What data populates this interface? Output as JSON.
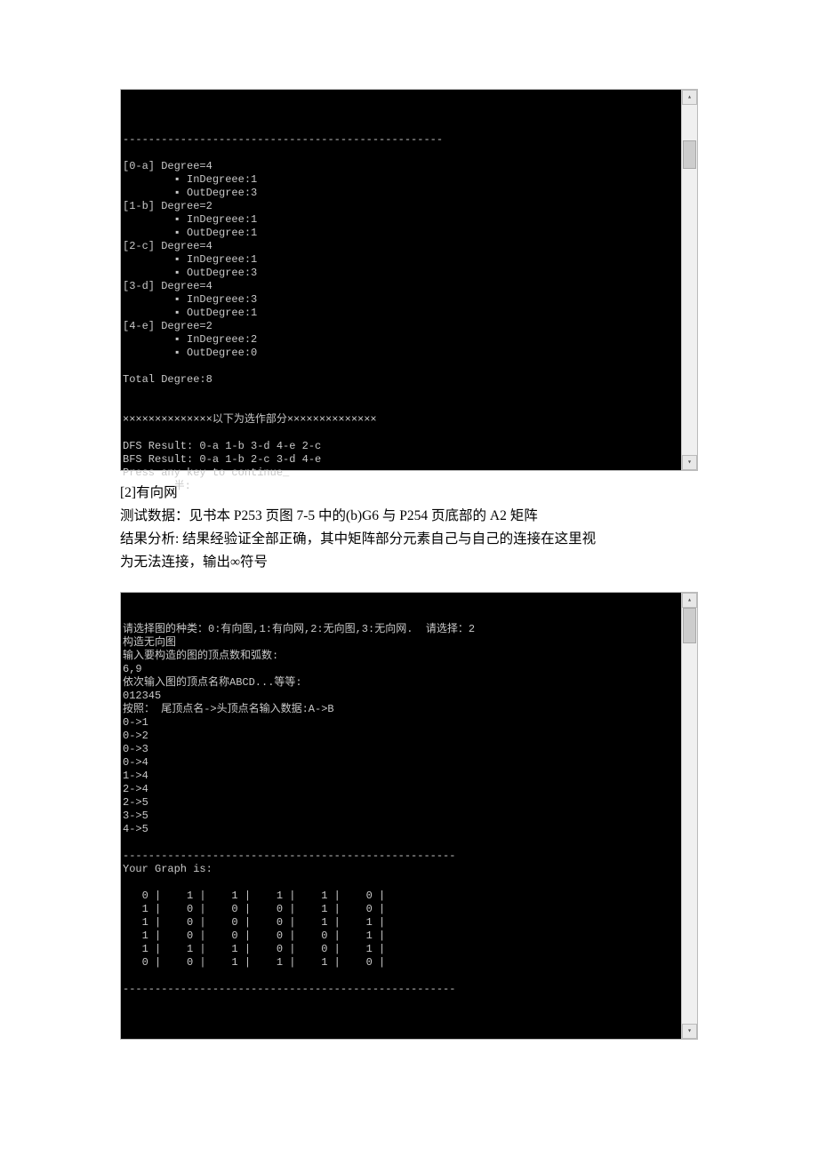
{
  "console1": {
    "divider": "--------------------------------------------------",
    "nodes": [
      {
        "header": "[0-a] Degree=4",
        "in": "▪ InDegreee:1",
        "out": "▪ OutDegree:3"
      },
      {
        "header": "[1-b] Degree=2",
        "in": "▪ InDegreee:1",
        "out": "▪ OutDegree:1"
      },
      {
        "header": "[2-c] Degree=4",
        "in": "▪ InDegreee:1",
        "out": "▪ OutDegree:3"
      },
      {
        "header": "[3-d] Degree=4",
        "in": "▪ InDegreee:3",
        "out": "▪ OutDegree:1"
      },
      {
        "header": "[4-e] Degree=2",
        "in": "▪ InDegreee:2",
        "out": "▪ OutDegree:0"
      }
    ],
    "total": "Total Degree:8",
    "section": "××××××××××××××以下为选作部分××××××××××××××",
    "dfs": "DFS Result: 0-a 1-b 3-d 4-e 2-c",
    "bfs": "BFS Result: 0-a 1-b 2-c 3-d 4-e",
    "pressKey": "Press any key to continue_",
    "tail": "        半:"
  },
  "doc": {
    "line1": "[2]有向网",
    "line2": "测试数据：见书本 P253 页图 7-5 中的(b)G6 与 P254 页底部的 A2 矩阵",
    "line3": "结果分析: 结果经验证全部正确，其中矩阵部分元素自己与自己的连接在这里视",
    "line4": "为无法连接，输出∞符号"
  },
  "console2": {
    "prompt": "请选择图的种类：0:有向图,1:有向网,2:无向图,3:无向网.  请选择：2",
    "build": "构造无向图",
    "inputVE": "输入要构造的图的顶点数和弧数:",
    "counts": "6,9",
    "inputNames": "依次输入图的顶点名称ABCD...等等:",
    "names": "012345",
    "edgeFormat": "按照： 尾顶点名->头顶点名输入数据:A->B",
    "edges": [
      "0->1",
      "0->2",
      "0->3",
      "0->4",
      "1->4",
      "2->4",
      "2->5",
      "3->5",
      "4->5"
    ],
    "dividerA": "----------------------------------------------------",
    "yourGraph": "Your Graph is:",
    "matrix": [
      "   0 |    1 |    1 |    1 |    1 |    0 |",
      "   1 |    0 |    0 |    0 |    1 |    0 |",
      "   1 |    0 |    0 |    0 |    1 |    1 |",
      "   1 |    0 |    0 |    0 |    0 |    1 |",
      "   1 |    1 |    1 |    0 |    0 |    1 |",
      "   0 |    0 |    1 |    1 |    1 |    0 |"
    ],
    "dividerB": "----------------------------------------------------"
  }
}
